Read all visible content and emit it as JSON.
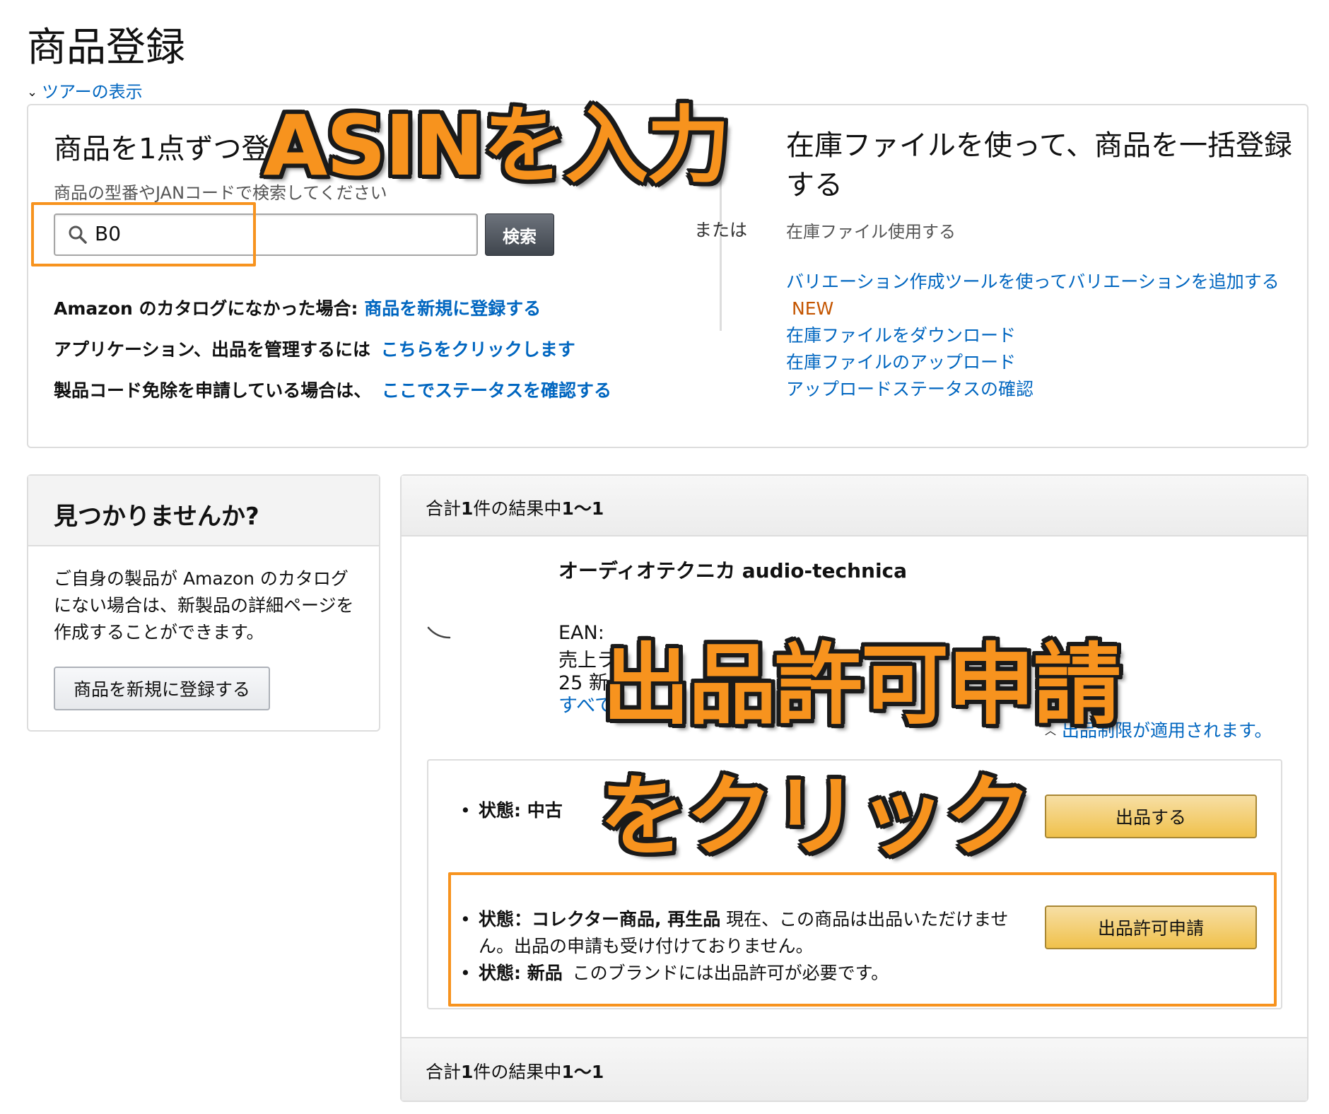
{
  "page": {
    "title": "商品登録",
    "tour_label": "ツアーの表示"
  },
  "single": {
    "title": "商品を1点ずつ登",
    "hint": "商品の型番やJANコードで検索してください",
    "search_value": "B0",
    "search_button": "検索",
    "rows": [
      {
        "prefix": "Amazon のカタログになかった場合:",
        "link": "商品を新規に登録する"
      },
      {
        "prefix": "アプリケーション、出品を管理するには",
        "link": "こちらをクリックします"
      },
      {
        "prefix": "製品コード免除を申請している場合は、",
        "link": "ここでステータスを確認する"
      }
    ]
  },
  "or_label": "または",
  "bulk": {
    "title": "在庫ファイルを使って、商品を一括登録する",
    "hint": "在庫ファイル使用する",
    "variation_link": "バリエーション作成ツールを使ってバリエーションを追加する",
    "new_badge": "NEW",
    "links": [
      "在庫ファイルをダウンロード",
      "在庫ファイルのアップロード",
      "アップロードステータスの確認"
    ]
  },
  "not_found": {
    "title": "見つかりませんか?",
    "body": "ご自身の製品が Amazon のカタログにない場合は、新製品の詳細ページを作成することができます。",
    "button": "商品を新規に登録する"
  },
  "results": {
    "count_text_prefix": "合計",
    "count_text_bold": "1",
    "count_text_mid": "件の結果中",
    "count_text_range": "1～1",
    "product": {
      "brand": "オーディオテクニカ audio-technica",
      "ean": "EAN:",
      "rank": "売上ラ",
      "offers": "25 新",
      "all_link": "すべて"
    },
    "restriction_toggle": "出品制限が適用されます。",
    "conditions": [
      {
        "label": "状態: 中古",
        "desc": ""
      },
      {
        "label": "状態：コレクター商品, 再生品",
        "desc": "現在、この商品は出品いただけません。出品の申請も受け付けておりません。"
      },
      {
        "label": "状態: 新品",
        "desc": "このブランドには出品許可が必要です。"
      }
    ],
    "sell_button": "出品する",
    "approval_button": "出品許可申請"
  },
  "annotations": {
    "asin": "ASINを入力",
    "approval": "出品許可申請",
    "click": "をクリック",
    "color": "#f7931e"
  }
}
